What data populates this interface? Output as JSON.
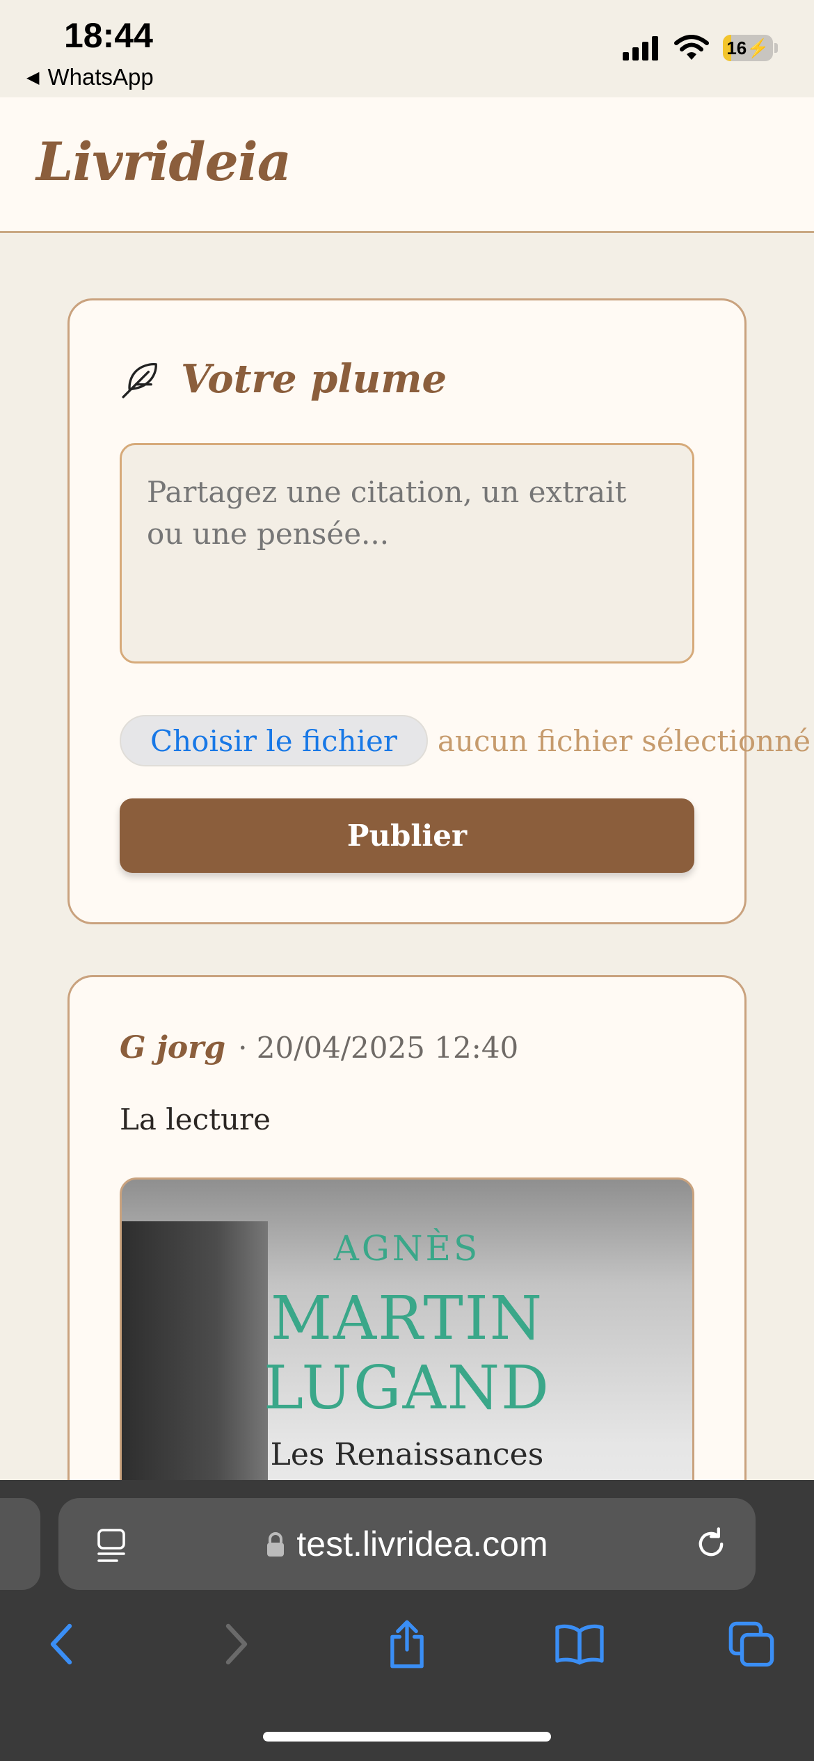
{
  "status_bar": {
    "time": "18:44",
    "back_label": "WhatsApp",
    "battery_level": 16,
    "battery_label": "16"
  },
  "header": {
    "brand": "Livrideia"
  },
  "composer": {
    "title": "Votre plume",
    "title_icon": "feather-icon",
    "placeholder": "Partagez une citation, un extrait ou une pensée...",
    "file_button_label": "Choisir le fichier",
    "file_status": "aucun fichier sélectionné",
    "publish_label": "Publier"
  },
  "post": {
    "author": "G jorg",
    "date": "· 20/04/2025 12:40",
    "text": "La lecture",
    "image": {
      "author_first": "AGNÈS",
      "author_last_1": "MARTIN",
      "author_last_2": "LUGAND",
      "book_title": "Les Renaissances"
    }
  },
  "browser": {
    "url": "test.livridea.com",
    "icons": [
      "reader-icon",
      "lock-icon",
      "reload-icon",
      "back-icon",
      "forward-icon",
      "share-icon",
      "bookmarks-icon",
      "tabs-icon"
    ]
  },
  "colors": {
    "background": "#f3efe6",
    "accent": "#8b5e3c",
    "border": "#c9a27e",
    "link": "#1878e6"
  }
}
